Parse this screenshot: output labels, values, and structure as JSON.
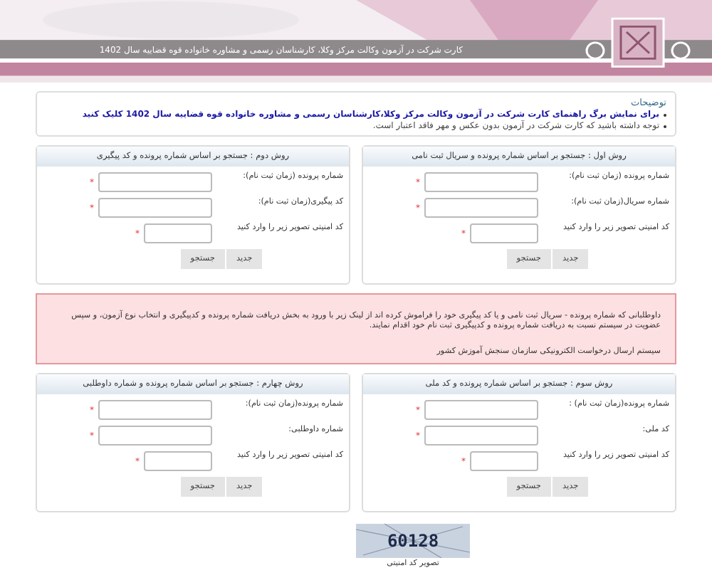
{
  "header": {
    "title": "کارت شرکت در آزمون وکالت مرکز وکلا، کارشناسان رسمی و مشاوره خانواده قوه قضاییه سال 1402"
  },
  "notes": {
    "title": "توضیحات",
    "items": [
      {
        "kind": "link",
        "text": "برای نمایش برگ راهنمای کارت شرکت در آزمون وکالت مرکز وکلا،کارشناسان رسمی و مشاوره خانواده قوه قضاییه سال 1402 کلیک کنید"
      },
      {
        "kind": "text",
        "text": "توجه داشته باشید که کارت شرکت در آزمون بدون عکس و مهر فاقد اعتبار است."
      }
    ]
  },
  "panels_top": [
    {
      "title": "روش اول : جستجو بر اساس شماره پرونده و سریال ثبت نامی",
      "fields": [
        {
          "label": "شماره پرونده (زمان ثبت نام):",
          "kind": "wide",
          "marker": "*"
        },
        {
          "label": "شماره سریال(زمان ثبت نام):",
          "kind": "wide",
          "marker": "*"
        },
        {
          "label": "کد امنیتی تصویر زیر را وارد کنید",
          "kind": "short",
          "marker": "*"
        }
      ],
      "buttons": [
        "جدید",
        "جستجو"
      ]
    },
    {
      "title": "روش دوم : جستجو بر اساس شماره پرونده و کد پیگیری",
      "fields": [
        {
          "label": "شماره پرونده (زمان ثبت نام):",
          "kind": "wide",
          "marker": "*"
        },
        {
          "label": "کد پیگیری(زمان ثبت نام):",
          "kind": "wide",
          "marker": "*"
        },
        {
          "label": "کد امنیتی تصویر زیر را وارد کنید",
          "kind": "short",
          "marker": "*"
        }
      ],
      "buttons": [
        "جدید",
        "جستجو"
      ]
    }
  ],
  "alert": {
    "text": "داوطلبانی که شماره پرونده - سریال ثبت نامی و یا کد پیگیری خود را فراموش کرده اند از لینک زیر با ورود به بخش دریافت شماره پرونده و کدپیگیری و انتخاب نوع آزمون، و سپس عضویت در سیستم نسبت به دریافت شماره پرونده و کدپیگیری ثبت نام خود اقدام نمایند.",
    "link": "سیستم ارسال درخواست الکترونیکی سازمان سنجش آموزش کشور"
  },
  "panels_bottom": [
    {
      "title": "روش سوم : جستجو بر اساس شماره پرونده و کد ملی",
      "fields": [
        {
          "label": "شماره پرونده(زمان ثبت نام) :",
          "kind": "wide",
          "marker": "*"
        },
        {
          "label": "کد ملی:",
          "kind": "wide",
          "marker": "*"
        },
        {
          "label": "کد امنیتی تصویر زیر را وارد کنید",
          "kind": "short",
          "marker": "*"
        }
      ],
      "buttons": [
        "جدید",
        "جستجو"
      ]
    },
    {
      "title": "روش چهارم : جستجو بر اساس شماره پرونده و شماره داوطلبی",
      "fields": [
        {
          "label": "شماره پرونده(زمان ثبت نام):",
          "kind": "wide",
          "marker": "*"
        },
        {
          "label": "شماره داوطلبی:",
          "kind": "wide",
          "marker": "*"
        },
        {
          "label": "کد امنیتی تصویر زیر را وارد کنید",
          "kind": "short",
          "marker": "*"
        }
      ],
      "buttons": [
        "جدید",
        "جستجو"
      ]
    }
  ],
  "captcha": {
    "code": "60128",
    "caption": "تصویر کد امنیتی"
  }
}
